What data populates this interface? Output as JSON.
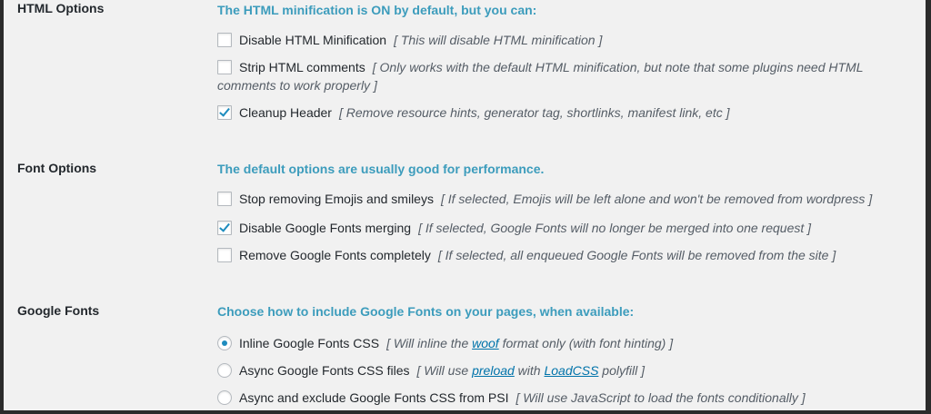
{
  "html_options": {
    "label": "HTML Options",
    "heading": "The HTML minification is ON by default, but you can:",
    "items": [
      {
        "label": "Disable HTML Minification",
        "checked": false,
        "desc": "[ This will disable HTML minification ]"
      },
      {
        "label": "Strip HTML comments",
        "checked": false,
        "desc": "[ Only works with the default HTML minification, but note that some plugins need HTML comments to work properly ]"
      },
      {
        "label": "Cleanup Header",
        "checked": true,
        "desc": "[ Remove resource hints, generator tag, shortlinks, manifest link, etc ]"
      }
    ]
  },
  "font_options": {
    "label": "Font Options",
    "heading": "The default options are usually good for performance.",
    "items": [
      {
        "label": "Stop removing Emojis and smileys",
        "checked": false,
        "desc": "[ If selected, Emojis will be left alone and won't be removed from wordpress ]"
      },
      {
        "label": "Disable Google Fonts merging",
        "checked": true,
        "desc": "[ If selected, Google Fonts will no longer be merged into one request ]"
      },
      {
        "label": "Remove Google Fonts completely",
        "checked": false,
        "desc": "[ If selected, all enqueued Google Fonts will be removed from the site ]"
      }
    ]
  },
  "google_fonts": {
    "label": "Google Fonts",
    "heading": "Choose how to include Google Fonts on your pages, when available:",
    "items": [
      {
        "label": "Inline Google Fonts CSS",
        "selected": true,
        "desc_pre": "[ Will inline the ",
        "link1": "woof",
        "desc_mid": " format only (with font hinting) ]"
      },
      {
        "label": "Async Google Fonts CSS files",
        "selected": false,
        "desc_pre": "[ Will use ",
        "link1": "preload",
        "desc_mid": " with ",
        "link2": "LoadCSS",
        "desc_post": " polyfill ]"
      },
      {
        "label": "Async and exclude Google Fonts CSS from PSI",
        "selected": false,
        "desc": "[ Will use JavaScript to load the fonts conditionally ]"
      }
    ]
  }
}
